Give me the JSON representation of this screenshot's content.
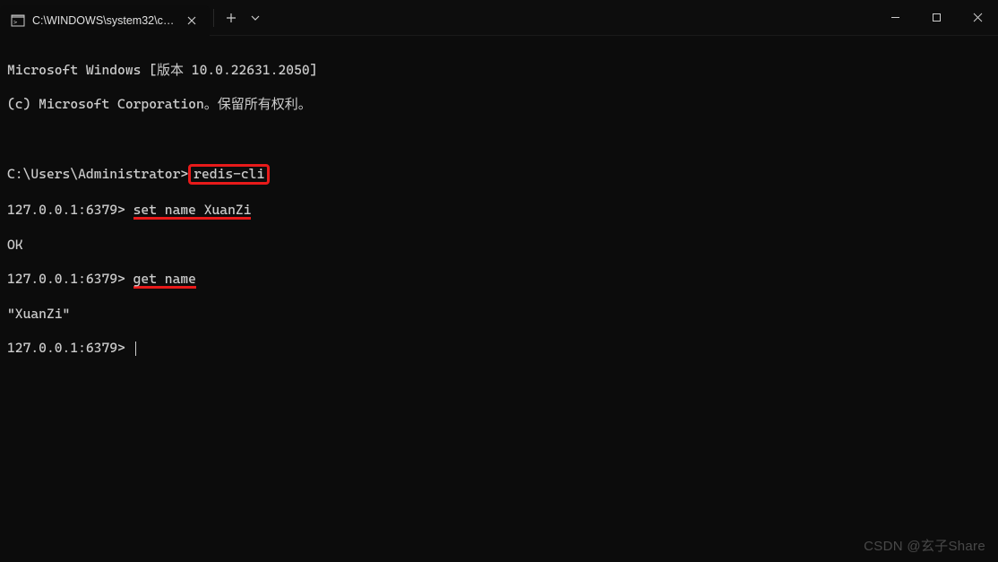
{
  "titlebar": {
    "tab_title": "C:\\WINDOWS\\system32\\cmd."
  },
  "terminal": {
    "header1": "Microsoft Windows [版本 10.0.22631.2050]",
    "header2": "(c) Microsoft Corporation。保留所有权利。",
    "prompt1": "C:\\Users\\Administrator>",
    "cmd1": "redis-cli",
    "redis_prompt": "127.0.0.1:6379> ",
    "cmd2": "set name XuanZi",
    "out2": "OK",
    "cmd3": "get name",
    "out3": "\"XuanZi\""
  },
  "watermark": "CSDN @玄子Share"
}
